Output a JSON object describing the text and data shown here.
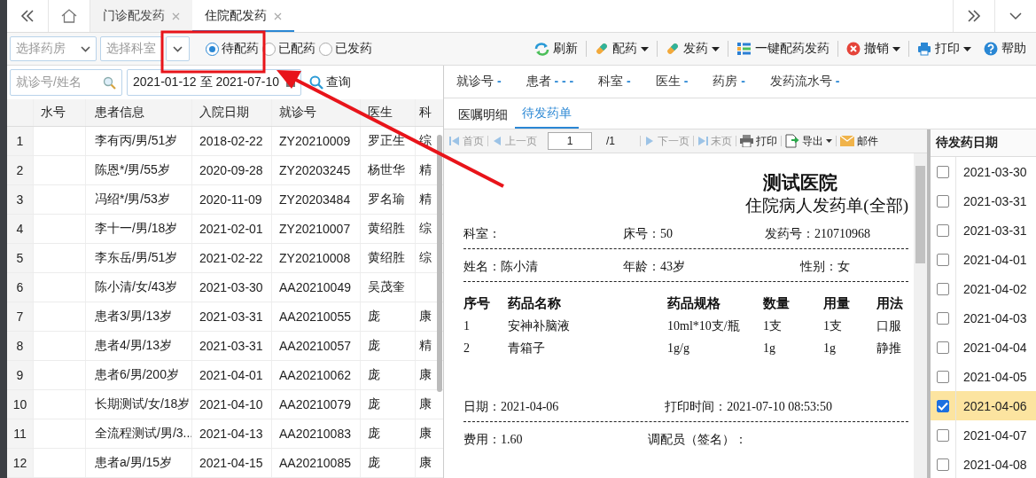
{
  "nav_tabs": [
    {
      "label": "门诊配发药",
      "selected": false
    },
    {
      "label": "住院配发药",
      "selected": true
    }
  ],
  "filters": {
    "pharmacy": {
      "placeholder": "选择药房"
    },
    "department": {
      "placeholder": "选择科室"
    },
    "status_options": [
      {
        "label": "待配药",
        "selected": true
      },
      {
        "label": "已配药",
        "selected": false
      },
      {
        "label": "已发药",
        "selected": false
      }
    ]
  },
  "toolbar": [
    {
      "kind": "refresh",
      "label": "刷新",
      "dropdown": false
    },
    {
      "kind": "dispense",
      "label": "配药",
      "dropdown": true
    },
    {
      "kind": "issue",
      "label": "发药",
      "dropdown": true
    },
    {
      "kind": "onekey",
      "label": "一键配药发药",
      "dropdown": false
    },
    {
      "kind": "cancel",
      "label": "撤销",
      "dropdown": true
    },
    {
      "kind": "print",
      "label": "打印",
      "dropdown": true
    },
    {
      "kind": "help",
      "label": "帮助",
      "dropdown": false
    }
  ],
  "search": {
    "placeholder": "就诊号/姓名",
    "date_range": "2021-01-12 至 2021-07-10",
    "query_button": "查询"
  },
  "patients": {
    "columns": [
      "水号",
      "患者信息",
      "入院日期",
      "就诊号",
      "医生",
      "科"
    ],
    "rows": [
      {
        "no": "1",
        "patient": "李有丙/男/51岁",
        "date": "2018-02-22",
        "visit": "ZY20210009",
        "doctor": "罗正生",
        "dept": "综"
      },
      {
        "no": "2",
        "patient": "陈恩*/男/55岁",
        "date": "2020-09-28",
        "visit": "ZY20203245",
        "doctor": "杨世华",
        "dept": "精"
      },
      {
        "no": "3",
        "patient": "冯绍*/男/53岁",
        "date": "2020-11-09",
        "visit": "ZY20203484",
        "doctor": "罗名瑜",
        "dept": "精"
      },
      {
        "no": "4",
        "patient": "李十一/男/18岁",
        "date": "2021-02-01",
        "visit": "ZY20210007",
        "doctor": "黄绍胜",
        "dept": "综"
      },
      {
        "no": "5",
        "patient": "李东岳/男/51岁",
        "date": "2021-02-22",
        "visit": "ZY20210008",
        "doctor": "黄绍胜",
        "dept": "综"
      },
      {
        "no": "6",
        "patient": "陈小清/女/43岁",
        "date": "2021-03-30",
        "visit": "AA20210049",
        "doctor": "吴茂奎"
      },
      {
        "no": "7",
        "patient": "患者3/男/13岁",
        "date": "2021-03-31",
        "visit": "AA20210055",
        "doctor": "庞",
        "dept": "康"
      },
      {
        "no": "8",
        "patient": "患者4/男/13岁",
        "date": "2021-03-31",
        "visit": "AA20210057",
        "doctor": "庞",
        "dept": "精"
      },
      {
        "no": "9",
        "patient": "患者6/男/200岁",
        "date": "2021-04-01",
        "visit": "AA20210062",
        "doctor": "庞",
        "dept": "康"
      },
      {
        "no": "10",
        "patient": "长期测试/女/18岁",
        "date": "2021-04-10",
        "visit": "AA20210079",
        "doctor": "庞",
        "dept": "康"
      },
      {
        "no": "11",
        "patient": "全流程测试/男/3...",
        "date": "2021-04-13",
        "visit": "AA20210083",
        "doctor": "庞",
        "dept": "康"
      },
      {
        "no": "12",
        "patient": "患者a/男/15岁",
        "date": "2021-04-15",
        "visit": "AA20210085",
        "doctor": "庞",
        "dept": "康"
      }
    ]
  },
  "info": [
    {
      "label": "就诊号",
      "value": "-"
    },
    {
      "label": "患者",
      "value": "- - -"
    },
    {
      "label": "科室",
      "value": "-"
    },
    {
      "label": "医生",
      "value": "-"
    },
    {
      "label": "药房",
      "value": "-"
    },
    {
      "label": "发药流水号",
      "value": "-"
    }
  ],
  "detail_tabs": [
    {
      "label": "医嘱明细",
      "selected": false
    },
    {
      "label": "待发药单",
      "selected": true
    }
  ],
  "pager": {
    "items": [
      {
        "kind": "first",
        "label": "首页",
        "disabled": true
      },
      {
        "kind": "prev",
        "label": "上一页",
        "disabled": true
      },
      {
        "kind": "page"
      },
      {
        "kind": "next",
        "label": "下一页",
        "disabled": true
      },
      {
        "kind": "last",
        "label": "末页",
        "disabled": true
      },
      {
        "kind": "print",
        "label": "打印",
        "disabled": false
      },
      {
        "kind": "export",
        "label": "导出",
        "disabled": false
      },
      {
        "kind": "mail",
        "label": "邮件",
        "disabled": false
      }
    ],
    "page": "1",
    "total": "/1"
  },
  "receipt": {
    "hospital": "测试医院",
    "title": "住院病人发药单(全部)",
    "row1": [
      "科室：",
      "床号：50",
      "发药号：210710968"
    ],
    "row2": [
      "姓名：陈小清",
      "年龄：43岁",
      "性别：女"
    ],
    "columns": [
      "序号",
      "药品名称",
      "药品规格",
      "数量",
      "用量",
      "用法"
    ],
    "items": [
      [
        "1",
        "安神补脑液",
        "10ml*10支/瓶",
        "1支",
        "1支",
        "口服"
      ],
      [
        "2",
        "青箱子",
        "1g/g",
        "1g",
        "1g",
        "静推"
      ]
    ],
    "date": "日期：2021-04-06",
    "print_time": "打印时间：2021-07-10 08:53:50",
    "fee": "费用：1.60",
    "dispenser": "调配员（签名）："
  },
  "dates": {
    "title": "待发药日期",
    "items": [
      {
        "date": "2021-03-30",
        "checked": false
      },
      {
        "date": "2021-03-31",
        "checked": false
      },
      {
        "date": "2021-03-31",
        "checked": false
      },
      {
        "date": "2021-04-01",
        "checked": false
      },
      {
        "date": "2021-04-02",
        "checked": false
      },
      {
        "date": "2021-04-03",
        "checked": false
      },
      {
        "date": "2021-04-04",
        "checked": false
      },
      {
        "date": "2021-04-05",
        "checked": false
      },
      {
        "date": "2021-04-06",
        "checked": true
      },
      {
        "date": "2021-04-07",
        "checked": false
      },
      {
        "date": "2021-04-08",
        "checked": false
      }
    ]
  }
}
